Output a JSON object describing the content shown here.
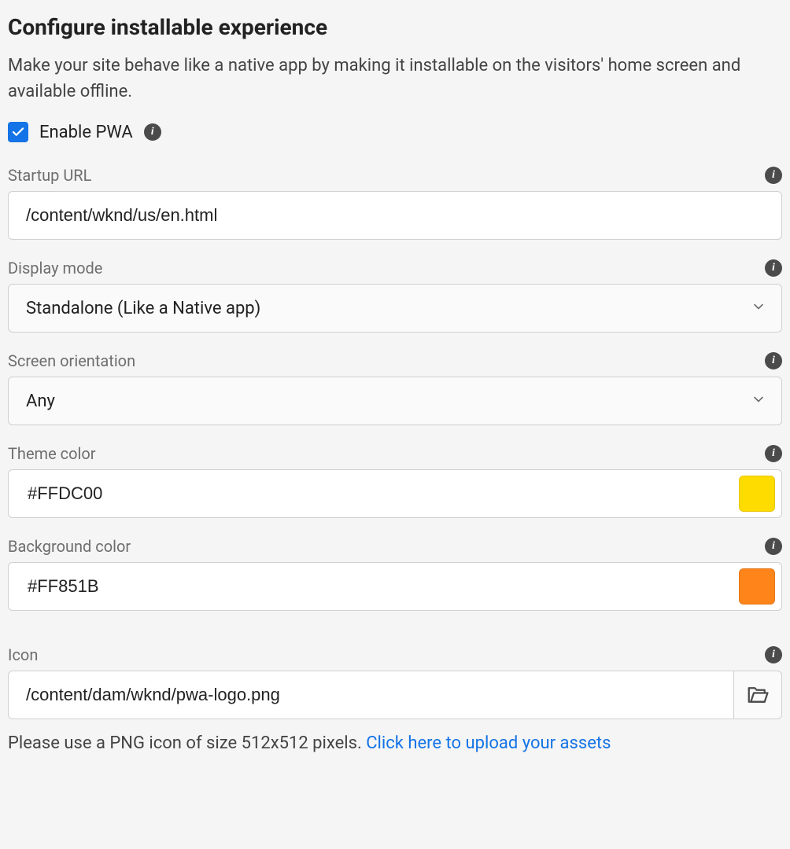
{
  "header": {
    "title": "Configure installable experience",
    "description": "Make your site behave like a native app by making it installable on the visitors' home screen and available offline."
  },
  "enable": {
    "label": "Enable PWA",
    "checked": true
  },
  "fields": {
    "startup_url": {
      "label": "Startup URL",
      "value": "/content/wknd/us/en.html"
    },
    "display_mode": {
      "label": "Display mode",
      "value": "Standalone (Like a Native app)"
    },
    "screen_orientation": {
      "label": "Screen orientation",
      "value": "Any"
    },
    "theme_color": {
      "label": "Theme color",
      "value": "#FFDC00",
      "swatch": "#FFDC00"
    },
    "background_color": {
      "label": "Background color",
      "value": "#FF851B",
      "swatch": "#FF851B"
    },
    "icon": {
      "label": "Icon",
      "value": "/content/dam/wknd/pwa-logo.png",
      "hint_prefix": "Please use a PNG icon of size 512x512 pixels. ",
      "hint_link": "Click here to upload your assets"
    }
  }
}
